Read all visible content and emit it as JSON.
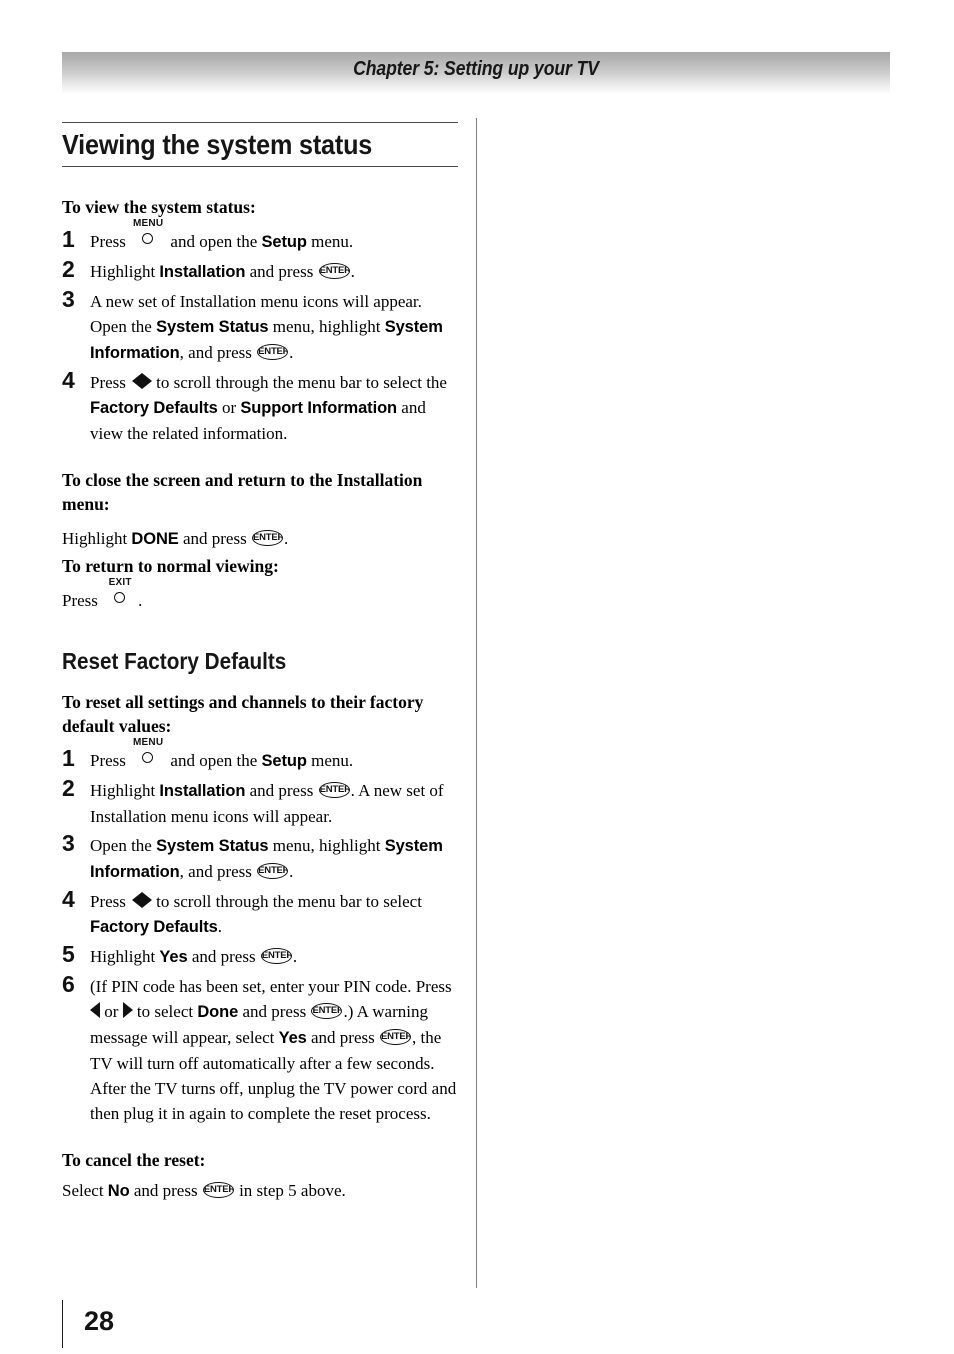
{
  "page": {
    "number": "28",
    "chapter_header": "Chapter 5: Setting up your TV"
  },
  "sections": [
    {
      "heading": "Viewing the system status",
      "lead_1": "To view the system status:",
      "steps": [
        {
          "num": "1",
          "parts": [
            {
              "t": "text",
              "v": "Press "
            },
            {
              "t": "key",
              "v": "MENU"
            },
            {
              "t": "text",
              "v": " and open the "
            },
            {
              "t": "ui",
              "v": "Setup"
            },
            {
              "t": "text",
              "v": " menu."
            }
          ]
        },
        {
          "num": "2",
          "parts": [
            {
              "t": "text",
              "v": "Highlight "
            },
            {
              "t": "ui",
              "v": "Installation"
            },
            {
              "t": "text",
              "v": " and press "
            },
            {
              "t": "enter",
              "v": "ENTER"
            },
            {
              "t": "text",
              "v": "."
            }
          ]
        },
        {
          "num": "3",
          "parts": [
            {
              "t": "text",
              "v": "A new set of Installation menu icons will appear. Open the "
            },
            {
              "t": "ui",
              "v": "System Status"
            },
            {
              "t": "text",
              "v": " menu, highlight "
            },
            {
              "t": "ui",
              "v": "System Information"
            },
            {
              "t": "text",
              "v": ", and press "
            },
            {
              "t": "enter",
              "v": "ENTER"
            },
            {
              "t": "text",
              "v": "."
            }
          ]
        },
        {
          "num": "4",
          "parts": [
            {
              "t": "text",
              "v": "Press "
            },
            {
              "t": "arrows",
              "v": "left-right"
            },
            {
              "t": "text",
              "v": "to scroll through the menu bar to select the "
            },
            {
              "t": "ui",
              "v": "Factory Defaults"
            },
            {
              "t": "text",
              "v": " or "
            },
            {
              "t": "ui",
              "v": "Support Information"
            },
            {
              "t": "text",
              "v": " and view the related information."
            }
          ]
        }
      ],
      "lead_2": "To close the screen and return to the Installation menu:",
      "para_1": [
        {
          "t": "text",
          "v": "Highlight "
        },
        {
          "t": "ui",
          "v": "DONE"
        },
        {
          "t": "text",
          "v": " and press "
        },
        {
          "t": "enter",
          "v": "ENTER"
        },
        {
          "t": "text",
          "v": "."
        }
      ],
      "lead_3": "To return to normal viewing:",
      "para_2": [
        {
          "t": "text",
          "v": "Press "
        },
        {
          "t": "key",
          "v": "EXIT"
        },
        {
          "t": "text",
          "v": "."
        }
      ]
    },
    {
      "heading": "Reset Factory Defaults",
      "lead_1": "To reset all settings and channels to their factory default values:",
      "steps": [
        {
          "num": "1",
          "parts": [
            {
              "t": "text",
              "v": "Press "
            },
            {
              "t": "key",
              "v": "MENU"
            },
            {
              "t": "text",
              "v": " and open the "
            },
            {
              "t": "ui",
              "v": "Setup"
            },
            {
              "t": "text",
              "v": " menu."
            }
          ]
        },
        {
          "num": "2",
          "parts": [
            {
              "t": "text",
              "v": "Highlight "
            },
            {
              "t": "ui",
              "v": "Installation"
            },
            {
              "t": "text",
              "v": " and press "
            },
            {
              "t": "enter",
              "v": "ENTER"
            },
            {
              "t": "text",
              "v": ". A new set of Installation menu icons will appear."
            }
          ]
        },
        {
          "num": "3",
          "parts": [
            {
              "t": "text",
              "v": "Open the "
            },
            {
              "t": "ui",
              "v": "System Status"
            },
            {
              "t": "text",
              "v": " menu, highlight "
            },
            {
              "t": "ui",
              "v": "System Information"
            },
            {
              "t": "text",
              "v": ", and press "
            },
            {
              "t": "enter",
              "v": "ENTER"
            },
            {
              "t": "text",
              "v": "."
            }
          ]
        },
        {
          "num": "4",
          "parts": [
            {
              "t": "text",
              "v": "Press "
            },
            {
              "t": "arrows",
              "v": "left-right"
            },
            {
              "t": "text",
              "v": "to scroll through the menu bar to select "
            },
            {
              "t": "ui",
              "v": "Factory Defaults"
            },
            {
              "t": "text",
              "v": "."
            }
          ]
        },
        {
          "num": "5",
          "parts": [
            {
              "t": "text",
              "v": "Highlight "
            },
            {
              "t": "ui",
              "v": "Yes"
            },
            {
              "t": "text",
              "v": " and press "
            },
            {
              "t": "enter",
              "v": "ENTER"
            },
            {
              "t": "text",
              "v": "."
            }
          ]
        },
        {
          "num": "6",
          "parts": [
            {
              "t": "text",
              "v": "(If PIN code has been set, enter your PIN code. Press "
            },
            {
              "t": "arrow-left",
              "v": "left"
            },
            {
              "t": "text",
              "v": " or "
            },
            {
              "t": "arrow-right",
              "v": "right"
            },
            {
              "t": "text",
              "v": " to select "
            },
            {
              "t": "ui",
              "v": "Done"
            },
            {
              "t": "text",
              "v": " and press "
            },
            {
              "t": "enter",
              "v": "ENTER"
            },
            {
              "t": "text",
              "v": ".) A warning message will appear, select "
            },
            {
              "t": "ui",
              "v": "Yes"
            },
            {
              "t": "text",
              "v": " and press "
            },
            {
              "t": "enter",
              "v": "ENTER"
            },
            {
              "t": "text",
              "v": ", the TV will turn off automatically after a few seconds. After the TV turns off, unplug the TV power cord and then plug it in again to complete the reset process."
            }
          ]
        }
      ],
      "lead_2": "To cancel the reset:",
      "para_1": [
        {
          "t": "text",
          "v": "Select "
        },
        {
          "t": "ui",
          "v": "No"
        },
        {
          "t": "text",
          "v": " and press "
        },
        {
          "t": "enter",
          "v": "ENTER"
        },
        {
          "t": "text",
          "v": " in step 5 above."
        }
      ]
    }
  ]
}
